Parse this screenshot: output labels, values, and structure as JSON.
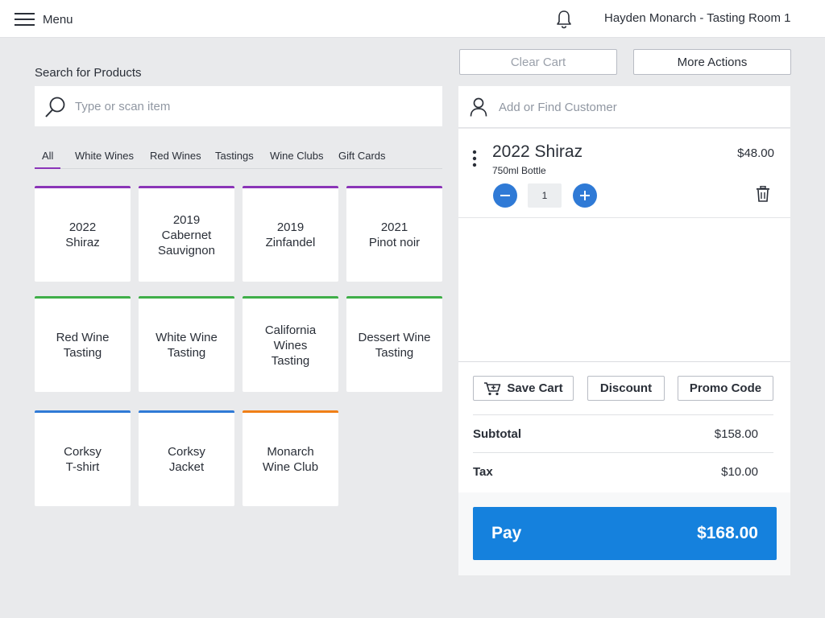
{
  "header": {
    "menu_label": "Menu",
    "user_label": "Hayden Monarch - Tasting Room 1"
  },
  "search": {
    "title": "Search for Products",
    "placeholder": "Type or scan item"
  },
  "tabs": [
    "All",
    "White Wines",
    "Red Wines",
    "Tastings",
    "Wine Clubs",
    "Gift Cards"
  ],
  "active_tab": "All",
  "products": [
    {
      "name": "2022\nShiraz",
      "category": "wine"
    },
    {
      "name": "2019 Cabernet Sauvignon",
      "category": "wine"
    },
    {
      "name": "2019\nZinfandel",
      "category": "wine"
    },
    {
      "name": "2021\nPinot noir",
      "category": "wine"
    },
    {
      "name": "Red Wine Tasting",
      "category": "tasting"
    },
    {
      "name": "White Wine Tasting",
      "category": "tasting"
    },
    {
      "name": "California Wines Tasting",
      "category": "tasting"
    },
    {
      "name": "Dessert Wine Tasting",
      "category": "tasting"
    },
    {
      "name": "Corksy\nT-shirt",
      "category": "merch"
    },
    {
      "name": "Corksy\nJacket",
      "category": "merch"
    },
    {
      "name": "Monarch Wine Club",
      "category": "club"
    }
  ],
  "category_colors": {
    "wine": "#8b35b8",
    "tasting": "#3fae49",
    "merch": "#2f7ad6",
    "club": "#f07f17"
  },
  "cart_actions": {
    "clear": "Clear Cart",
    "more": "More Actions"
  },
  "customer": {
    "placeholder": "Add or Find Customer"
  },
  "cart_item": {
    "name": "2022 Shiraz",
    "variant": "750ml Bottle",
    "price": "$48.00",
    "quantity": "1"
  },
  "footer_buttons": {
    "save": "Save Cart",
    "discount": "Discount",
    "promo": "Promo Code"
  },
  "totals": {
    "subtotal_label": "Subtotal",
    "subtotal": "$158.00",
    "tax_label": "Tax",
    "tax": "$10.00"
  },
  "pay": {
    "label": "Pay",
    "amount": "$168.00"
  },
  "colors": {
    "accent": "#1581dd",
    "qty_button": "#2f7ad6"
  }
}
